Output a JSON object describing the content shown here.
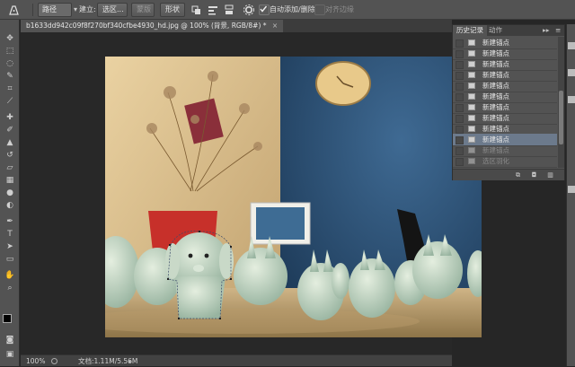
{
  "options_bar": {
    "mode_select": "路径",
    "build_label": "建立:",
    "selection_button": "选区...",
    "mask_button": "蒙版",
    "shape_button": "形状",
    "auto_add_delete_label": "自动添加/删除",
    "auto_add_delete_checked": true,
    "align_edges_label": "对齐边缘",
    "align_edges_checked": false
  },
  "document": {
    "tab_title": "b1633dd942c09f8f270bf340cfbe4930_hd.jpg @ 100% (背景, RGB/8#)",
    "modified_marker": "*",
    "close_glyph": "×"
  },
  "status_bar": {
    "zoom": "100%",
    "doc_info": "文档:1.11M/5.56M"
  },
  "history_panel": {
    "tabs": [
      "历史记录",
      "动作"
    ],
    "active_tab": 0,
    "items": [
      {
        "label": "新建锚点",
        "state": "normal"
      },
      {
        "label": "新建锚点",
        "state": "normal"
      },
      {
        "label": "新建锚点",
        "state": "normal"
      },
      {
        "label": "新建锚点",
        "state": "normal"
      },
      {
        "label": "新建锚点",
        "state": "normal"
      },
      {
        "label": "新建锚点",
        "state": "normal"
      },
      {
        "label": "新建锚点",
        "state": "normal"
      },
      {
        "label": "新建锚点",
        "state": "normal"
      },
      {
        "label": "新建锚点",
        "state": "normal"
      },
      {
        "label": "新建锚点",
        "state": "selected"
      },
      {
        "label": "新建锚点",
        "state": "dim"
      },
      {
        "label": "选区羽化",
        "state": "dim"
      }
    ]
  },
  "colors": {
    "ui_bg": "#535353",
    "canvas_bg": "#282828",
    "selected_row": "#6c7a8c"
  },
  "icons": {
    "tool_preset": "pen-icon",
    "tools": [
      "move-icon",
      "marquee-icon",
      "lasso-icon",
      "quick-select-icon",
      "crop-icon",
      "eyedropper-icon",
      "healing-icon",
      "brush-icon",
      "stamp-icon",
      "history-brush-icon",
      "eraser-icon",
      "gradient-icon",
      "blur-icon",
      "dodge-icon",
      "pen-icon",
      "type-icon",
      "path-select-icon",
      "shape-icon",
      "hand-icon",
      "zoom-icon",
      "color-swatch-icon",
      "quick-mask-icon",
      "screen-mode-icon"
    ]
  }
}
